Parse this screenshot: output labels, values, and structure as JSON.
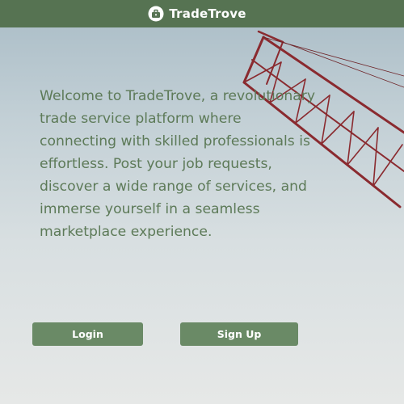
{
  "header": {
    "brand_name": "TradeTrove",
    "brand_icon": "briefcase-icon",
    "background_color": "#567352"
  },
  "hero": {
    "welcome_text": "Welcome to TradeTrove, a revolutionary trade service platform where connecting with skilled professionals is effortless. Post your job requests, discover a wide range of services, and immerse yourself in a seamless marketplace experience.",
    "background_image": "construction crane against sky"
  },
  "actions": {
    "login_label": "Login",
    "signup_label": "Sign Up",
    "button_color": "#6a8a66"
  },
  "colors": {
    "text_accent": "#5d7a58",
    "crane_red": "#8a2a2f"
  }
}
